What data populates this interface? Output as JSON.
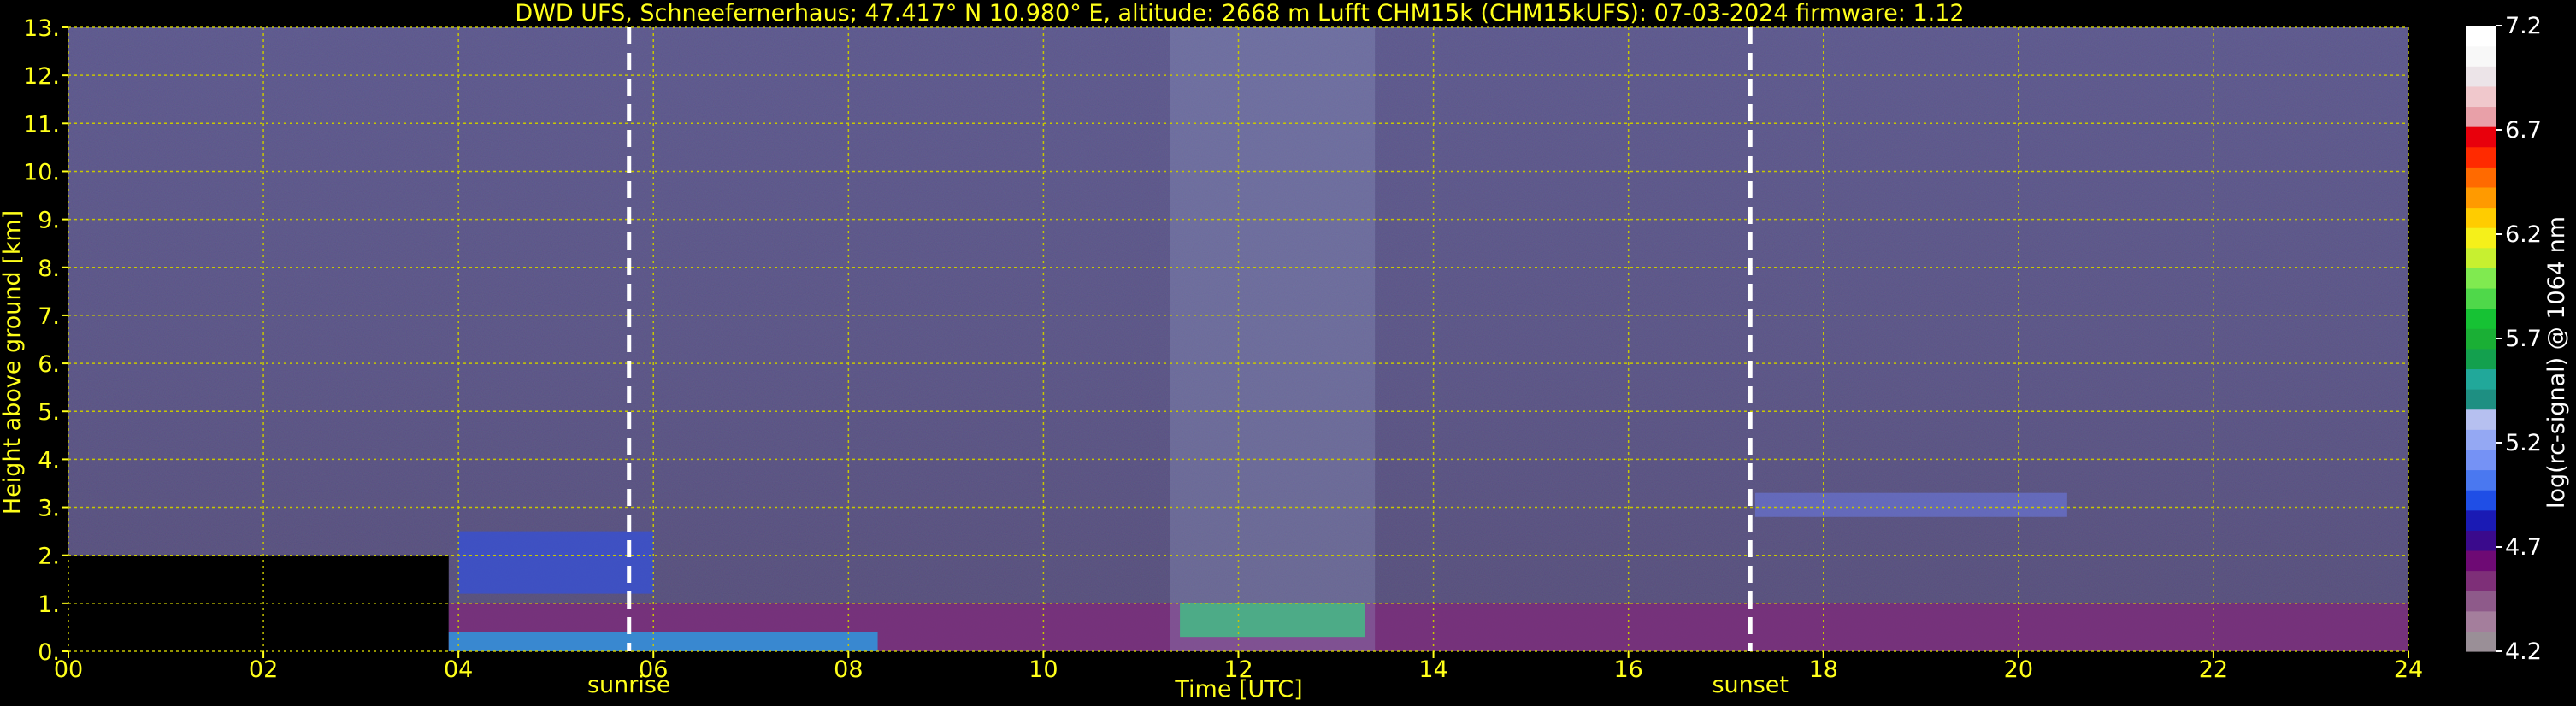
{
  "chart_data": {
    "type": "heatmap",
    "title": "DWD UFS, Schneefernerhaus; 47.417° N 10.980° E, altitude: 2668 m    Lufft CHM15k (CHM15kUFS): 07-03-2024    firmware: 1.12",
    "xlabel": "Time [UTC]",
    "ylabel": "Height above ground [km]",
    "xlim": [
      0,
      24
    ],
    "ylim": [
      0,
      13
    ],
    "x_ticks": [
      "00",
      "02",
      "04",
      "06",
      "08",
      "10",
      "12",
      "14",
      "16",
      "18",
      "20",
      "22",
      "24"
    ],
    "y_ticks": [
      "0.",
      "1.",
      "2.",
      "3.",
      "4.",
      "5.",
      "6.",
      "7.",
      "8.",
      "9.",
      "10.",
      "11.",
      "12.",
      "13."
    ],
    "grid": true,
    "events": [
      {
        "label": "sunrise",
        "time_utc": 5.75
      },
      {
        "label": "sunset",
        "time_utc": 17.25
      }
    ],
    "colorbar": {
      "label": "log(rc-signal) @ 1064 nm",
      "range": [
        4.2,
        7.2
      ],
      "ticks": [
        "4.2",
        "4.7",
        "5.2",
        "5.7",
        "6.2",
        "6.7",
        "7.2"
      ],
      "colors": [
        "#9a8f97",
        "#a47e9c",
        "#8e5a8a",
        "#7e2f78",
        "#6e0a74",
        "#3a0a8c",
        "#1a1ab4",
        "#1f4ee6",
        "#4a78f0",
        "#7592f5",
        "#94a8f3",
        "#b6c0f0",
        "#1e8f82",
        "#21a89a",
        "#13a04e",
        "#1aaf35",
        "#16c234",
        "#4fd84a",
        "#80ea50",
        "#c7f030",
        "#f5f01a",
        "#ffcc00",
        "#ff9a00",
        "#ff6a00",
        "#ff2a00",
        "#e8000c",
        "#e8a0a8",
        "#f0c8cc",
        "#ece4e8",
        "#f8f8f8",
        "#ffffff"
      ]
    },
    "layers": [
      {
        "feature": "no-data / black region",
        "x": [
          0.0,
          3.9
        ],
        "height_km": [
          0.0,
          2.0
        ]
      },
      {
        "feature": "boundary layer aerosol (purple/blue)",
        "x": [
          3.9,
          24.0
        ],
        "height_km": [
          0.0,
          1.0
        ]
      },
      {
        "feature": "elevated aerosol layer (blue)",
        "x": [
          4.0,
          6.0
        ],
        "height_km": [
          1.2,
          2.5
        ]
      },
      {
        "feature": "elevated aerosol layer (blue)",
        "x": [
          17.3,
          20.5
        ],
        "height_km": [
          2.8,
          3.3
        ]
      },
      {
        "feature": "low cloud (green/white)",
        "x": [
          11.4,
          13.3
        ],
        "height_km": [
          0.3,
          1.0
        ]
      },
      {
        "feature": "precipitation / virga streaks",
        "x": [
          11.3,
          13.4
        ],
        "height_km": [
          0.0,
          13.0
        ]
      },
      {
        "feature": "surface signal (multicolor)",
        "x": [
          3.9,
          8.3
        ],
        "height_km": [
          0.0,
          0.4
        ]
      }
    ]
  }
}
